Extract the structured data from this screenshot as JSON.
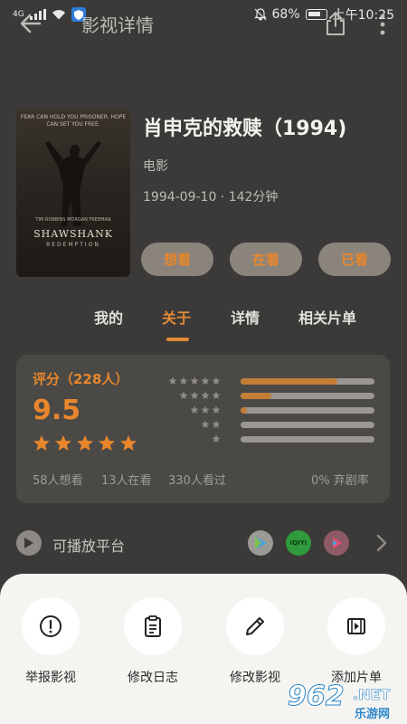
{
  "status_bar": {
    "signal": "4G",
    "battery": "68%",
    "time": "上午10:25"
  },
  "app_bar": {
    "title": "影视详情"
  },
  "movie": {
    "title": "肖申克的救赎（1994)",
    "type": "电影",
    "meta": "1994-09-10 · 142分钟",
    "poster": {
      "tagline": "FEAR CAN HOLD YOU PRISONER. HOPE CAN SET YOU FREE.",
      "credits": "TIM ROBBINS  MORGAN FREEMAN",
      "title": "SHAWSHANK",
      "subtitle": "REDEMPTION"
    },
    "buttons": [
      "想看",
      "在看",
      "已看"
    ]
  },
  "tabs": [
    "我的",
    "关于",
    "详情",
    "相关片单"
  ],
  "active_tab": "关于",
  "rating": {
    "label": "评分（228人）",
    "score": "9.5",
    "stars_filled": 5,
    "distribution": [
      {
        "stars": 5,
        "fraction": 0.72
      },
      {
        "stars": 4,
        "fraction": 0.23
      },
      {
        "stars": 3,
        "fraction": 0.04
      },
      {
        "stars": 2,
        "fraction": 0.0
      },
      {
        "stars": 1,
        "fraction": 0.0
      }
    ],
    "stats": {
      "want": "58人想看",
      "watching": "13人在看",
      "watched": "330人看过",
      "dropped": "0% 弃剧率"
    }
  },
  "platforms": {
    "label": "可播放平台",
    "apps": [
      "tencent-video-icon",
      "iqiyi-icon",
      "youku-icon"
    ],
    "iqiyi_text": "iQIYI"
  },
  "sheet": {
    "actions": [
      {
        "label": "举报影视",
        "icon": "alert-icon"
      },
      {
        "label": "修改日志",
        "icon": "clipboard-icon"
      },
      {
        "label": "修改影视",
        "icon": "pencil-icon"
      },
      {
        "label": "添加片单",
        "icon": "film-icon"
      }
    ]
  },
  "watermark": {
    "number": "962",
    "suffix": ".NET",
    "site": "乐游网"
  },
  "colors": {
    "accent": "#e8862c",
    "background": "#3b3a38",
    "sheet": "#f6f4f1"
  }
}
